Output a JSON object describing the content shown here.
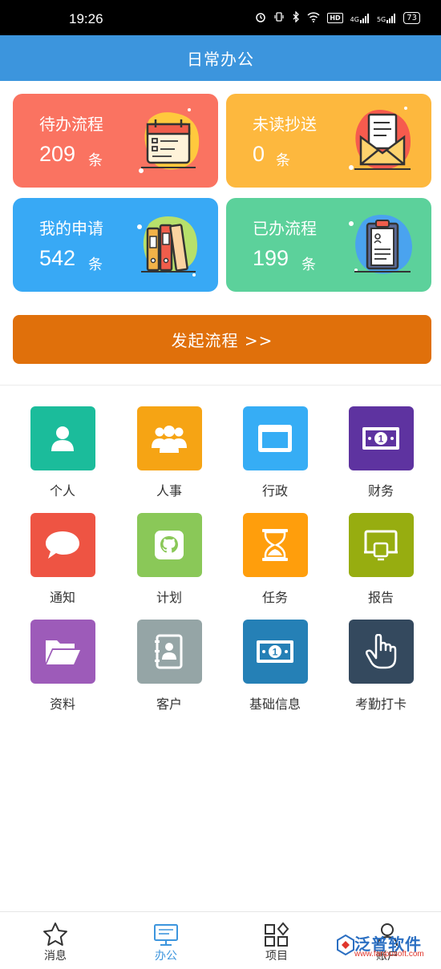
{
  "status_bar": {
    "time": "19:26",
    "hd_label": "HD",
    "signal_4g": "4G",
    "signal_5g": "5G",
    "battery": "73"
  },
  "header": {
    "title": "日常办公"
  },
  "cards": [
    {
      "title": "待办流程",
      "count": "209",
      "unit": "条",
      "color": "#fa7361",
      "icon": "calendar-checklist-icon"
    },
    {
      "title": "未读抄送",
      "count": "0",
      "unit": "条",
      "color": "#fdb83e",
      "icon": "envelope-document-icon"
    },
    {
      "title": "我的申请",
      "count": "542",
      "unit": "条",
      "color": "#38a9f5",
      "icon": "binders-icon"
    },
    {
      "title": "已办流程",
      "count": "199",
      "unit": "条",
      "color": "#5cd19b",
      "icon": "clipboard-icon"
    }
  ],
  "start_button": {
    "label": "发起流程 >>"
  },
  "grid": [
    {
      "label": "个人",
      "color": "#1bbc9b",
      "icon": "person-icon"
    },
    {
      "label": "人事",
      "color": "#f6a414",
      "icon": "group-icon"
    },
    {
      "label": "行政",
      "color": "#36adf5",
      "icon": "window-icon"
    },
    {
      "label": "财务",
      "color": "#5e33a0",
      "icon": "banknote-icon"
    },
    {
      "label": "通知",
      "color": "#ee5443",
      "icon": "chat-bubble-icon"
    },
    {
      "label": "计划",
      "color": "#8ac858",
      "icon": "github-icon"
    },
    {
      "label": "任务",
      "color": "#ff9e0c",
      "icon": "hourglass-icon"
    },
    {
      "label": "报告",
      "color": "#97ad10",
      "icon": "presentation-icon"
    },
    {
      "label": "资料",
      "color": "#9d5bb9",
      "icon": "folder-open-icon"
    },
    {
      "label": "客户",
      "color": "#95a5a6",
      "icon": "address-book-icon"
    },
    {
      "label": "基础信息",
      "color": "#2580b6",
      "icon": "banknote-icon"
    },
    {
      "label": "考勤打卡",
      "color": "#34495e",
      "icon": "pointing-hand-icon"
    }
  ],
  "bottom_nav": [
    {
      "label": "消息",
      "icon": "star-icon",
      "active": false
    },
    {
      "label": "办公",
      "icon": "desktop-icon",
      "active": true
    },
    {
      "label": "项目",
      "icon": "grid-shapes-icon",
      "active": false
    },
    {
      "label": "账户",
      "icon": "user-icon",
      "active": false
    }
  ],
  "watermark": {
    "brand": "泛普软件",
    "url": "www.fanpusoft.com"
  },
  "accent_color": "#3c95dd"
}
